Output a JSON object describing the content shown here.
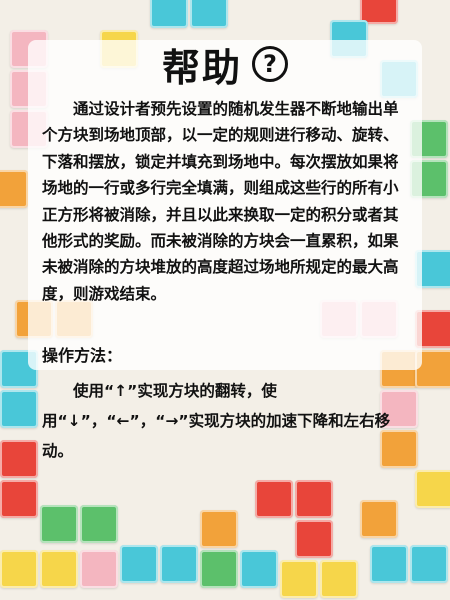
{
  "header": {
    "title": "帮助",
    "help_icon_glyph": "?"
  },
  "description": "通过设计者预先设置的随机发生器不断地输出单个方块到场地顶部，以一定的规则进行移动、旋转、下落和摆放，锁定并填充到场地中。每次摆放如果将场地的一行或多行完全填满，则组成这些行的所有小正方形将被消除，并且以此来换取一定的积分或者其他形式的奖励。而未被消除的方块会一直累积，如果未被消除的方块堆放的高度超过场地所规定的最大高度，则游戏结束。",
  "controls": {
    "heading": "操作方法：",
    "text": "使用“↑”实现方块的翻转，使用“↓”，“←”，“→”实现方块的加速下降和左右移动。"
  },
  "colors": {
    "accent_red": "#e8453a",
    "accent_orange": "#f2a23a",
    "accent_yellow": "#f6d64a",
    "accent_green": "#5cc06b",
    "accent_cyan": "#49c7d8",
    "accent_pink": "#f4b6c0"
  }
}
